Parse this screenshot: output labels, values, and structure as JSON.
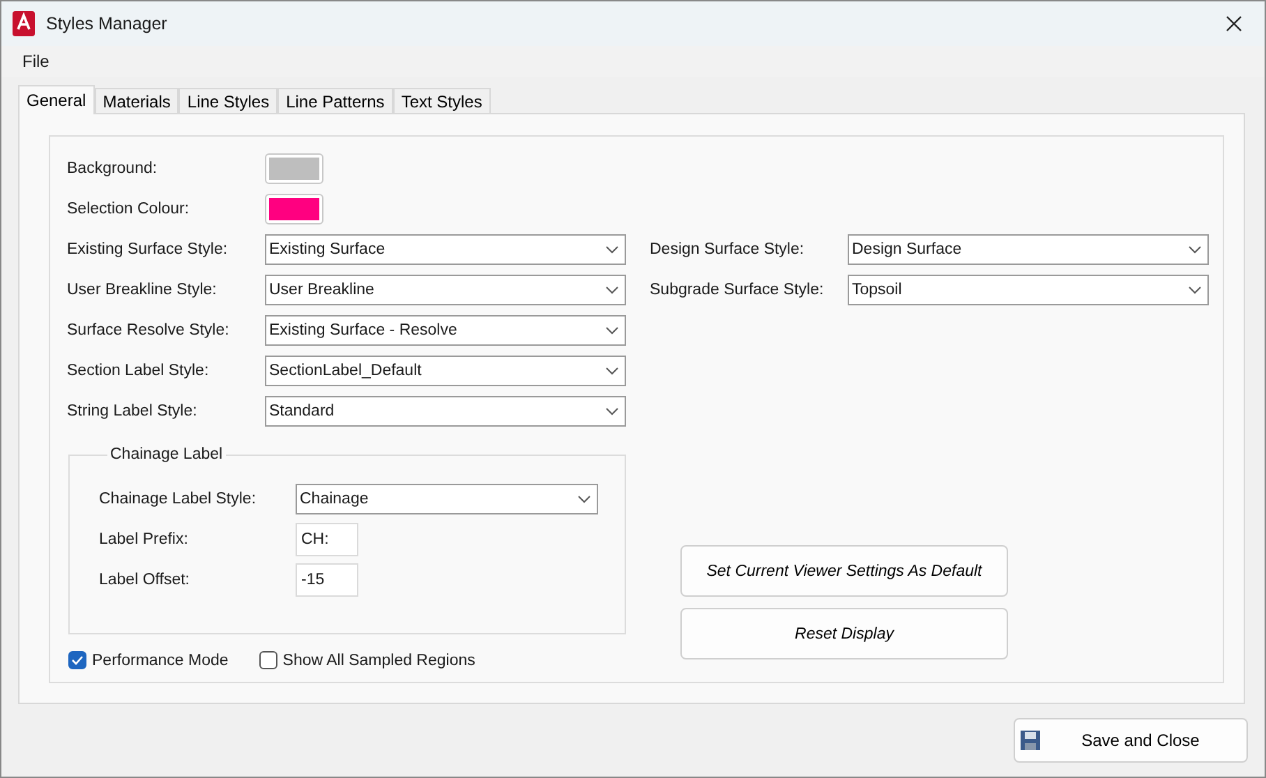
{
  "window": {
    "title": "Styles Manager"
  },
  "menu": [
    "File"
  ],
  "tabs": [
    {
      "label": "General",
      "selected": true
    },
    {
      "label": "Materials",
      "selected": false
    },
    {
      "label": "Line Styles",
      "selected": false
    },
    {
      "label": "Line Patterns",
      "selected": false
    },
    {
      "label": "Text Styles",
      "selected": false
    }
  ],
  "colours": [
    {
      "label": "Background:",
      "color": "#bebebe"
    },
    {
      "label": "Selection Colour:",
      "color": "#ff0080"
    }
  ],
  "left_fields": [
    {
      "label": "Existing Surface Style:",
      "value": "Existing Surface"
    },
    {
      "label": "User Breakline Style:",
      "value": "User Breakline"
    },
    {
      "label": "Surface Resolve Style:",
      "value": "Existing Surface - Resolve"
    },
    {
      "label": "Section Label Style:",
      "value": "SectionLabel_Default"
    },
    {
      "label": "String Label Style:",
      "value": "Standard"
    }
  ],
  "right_fields": [
    {
      "label": "Design Surface Style:",
      "value": "Design Surface"
    },
    {
      "label": "Subgrade Surface Style:",
      "value": "Topsoil"
    }
  ],
  "chainage_group": {
    "title": "Chainage Label",
    "fields": [
      {
        "kind": "dropdown",
        "label": "Chainage Label Style:",
        "value": "Chainage"
      },
      {
        "kind": "input",
        "label": "Label Prefix:",
        "value": "CH:"
      },
      {
        "kind": "input",
        "label": "Label Offset:",
        "value": "-15"
      }
    ]
  },
  "checkboxes": [
    {
      "label": "Performance Mode",
      "checked": true
    },
    {
      "label": "Show All Sampled Regions",
      "checked": false
    }
  ],
  "buttons": [
    "Set Current Viewer Settings As Default",
    "Reset Display"
  ],
  "footer_button": "Save and Close"
}
